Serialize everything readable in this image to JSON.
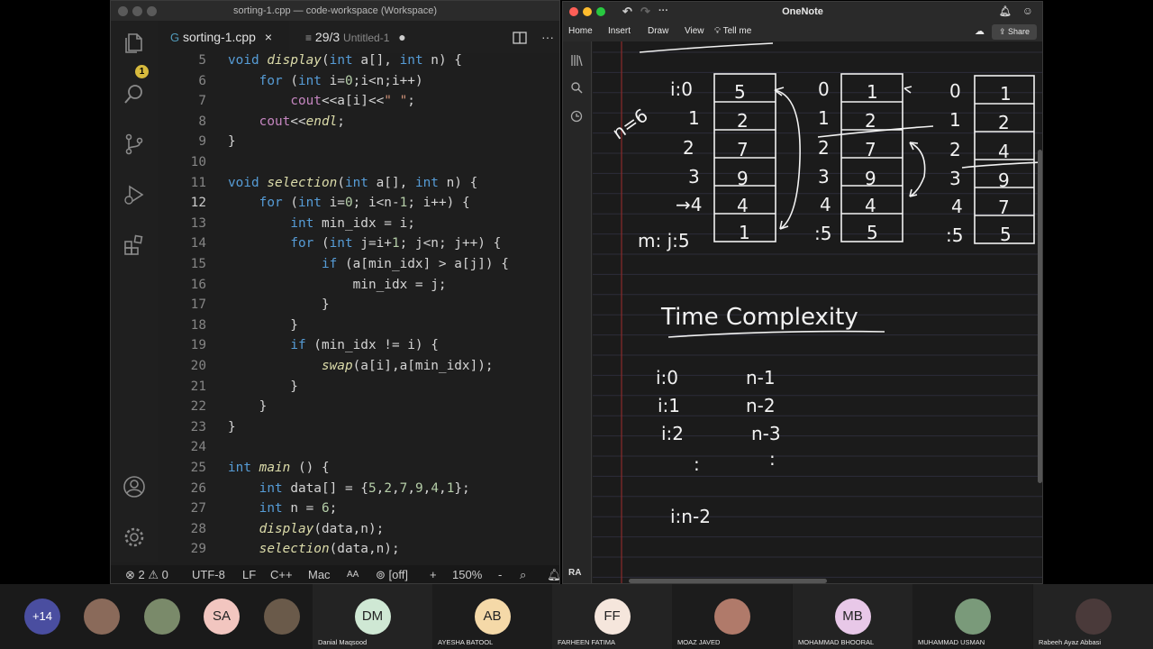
{
  "vscode": {
    "window_title": "sorting-1.cpp — code-workspace (Workspace)",
    "explorer_badge": "1",
    "tabs": [
      {
        "label": "sorting-1.cpp",
        "close": "×"
      },
      {
        "label": "29/3",
        "sublabel": "Untitled-1",
        "dirty": "●"
      }
    ],
    "more": "···",
    "status": {
      "errors": "2",
      "warnings": "0",
      "encoding": "UTF-8",
      "eol": "LF",
      "language": "C++",
      "platform": "Mac",
      "case": "AA",
      "live": "[off]",
      "plus": "+",
      "zoom": "150%",
      "minus": "-"
    }
  },
  "code_lines": [
    {
      "n": "5",
      "text": "void display(int a[], int n) {"
    },
    {
      "n": "6",
      "text": "    for (int i=0;i<n;i++)"
    },
    {
      "n": "7",
      "text": "        cout<<a[i]<<\" \";"
    },
    {
      "n": "8",
      "text": "    cout<<endl;"
    },
    {
      "n": "9",
      "text": "}"
    },
    {
      "n": "10",
      "text": ""
    },
    {
      "n": "11",
      "text": "void selection(int a[], int n) {"
    },
    {
      "n": "12",
      "text": "    for (int i=0; i<n-1; i++) {"
    },
    {
      "n": "13",
      "text": "        int min_idx = i;"
    },
    {
      "n": "14",
      "text": "        for (int j=i+1; j<n; j++) {"
    },
    {
      "n": "15",
      "text": "            if (a[min_idx] > a[j]) {"
    },
    {
      "n": "16",
      "text": "                min_idx = j;"
    },
    {
      "n": "17",
      "text": "            }"
    },
    {
      "n": "18",
      "text": "        }"
    },
    {
      "n": "19",
      "text": "        if (min_idx != i) {"
    },
    {
      "n": "20",
      "text": "            swap(a[i],a[min_idx]);"
    },
    {
      "n": "21",
      "text": "        }"
    },
    {
      "n": "22",
      "text": "    }"
    },
    {
      "n": "23",
      "text": "}"
    },
    {
      "n": "24",
      "text": ""
    },
    {
      "n": "25",
      "text": "int main () {"
    },
    {
      "n": "26",
      "text": "    int data[] = {5,2,7,9,4,1};"
    },
    {
      "n": "27",
      "text": "    int n = 6;"
    },
    {
      "n": "28",
      "text": "    display(data,n);"
    },
    {
      "n": "29",
      "text": "    selection(data,n);"
    }
  ],
  "onenote": {
    "title": "OneNote",
    "menu": [
      "Home",
      "Insert",
      "Draw",
      "View",
      "Tell me"
    ],
    "share": "Share",
    "user_initials": "RA",
    "notes": {
      "n_label": "n=6",
      "arrays": [
        {
          "indices": [
            "i:0",
            "1",
            "2",
            "3",
            "→4",
            "m: j:5"
          ],
          "values": [
            "5",
            "2",
            "7",
            "9",
            "4",
            "1"
          ]
        },
        {
          "indices": [
            "0",
            "1",
            "2",
            "3",
            "4",
            ":5"
          ],
          "values": [
            "1",
            "2",
            "7",
            "9",
            "4",
            "5"
          ]
        },
        {
          "indices": [
            "0",
            "1",
            "2",
            "3",
            "4",
            ":5"
          ],
          "values": [
            "1",
            "2",
            "4",
            "9",
            "7",
            "5"
          ]
        }
      ],
      "heading": "Time Complexity",
      "rows": [
        {
          "i": "i:0",
          "cost": "n-1"
        },
        {
          "i": "i:1",
          "cost": "n-2"
        },
        {
          "i": "i:2",
          "cost": "n-3"
        }
      ],
      "dots": ":",
      "last": "i:n-2"
    }
  },
  "meeting": {
    "more_count": "+14",
    "participants": [
      {
        "initials": "",
        "name": "",
        "color": "#8a6a5a"
      },
      {
        "initials": "",
        "name": "",
        "color": "#7a8a6a"
      },
      {
        "initials": "SA",
        "name": "",
        "color": "#f2c6c0"
      },
      {
        "initials": "",
        "name": "",
        "color": "#6a5a4a"
      },
      {
        "initials": "DM",
        "name": "Danial Maqsood",
        "color": "#cfe8d4"
      },
      {
        "initials": "AB",
        "name": "AYESHA BATOOL",
        "color": "#f5d9a8"
      },
      {
        "initials": "FF",
        "name": "FARHEEN FATIMA",
        "color": "#f5e6dc"
      },
      {
        "initials": "",
        "name": "MOAZ JAVED",
        "color": "#b07a6a"
      },
      {
        "initials": "MB",
        "name": "MOHAMMAD BHOORAL",
        "color": "#e8c8e8"
      },
      {
        "initials": "",
        "name": "MUHAMMAD USMAN",
        "color": "#7a9a7a"
      },
      {
        "initials": "",
        "name": "Rabeeh Ayaz Abbasi",
        "color": "#4a3a3a"
      }
    ]
  }
}
